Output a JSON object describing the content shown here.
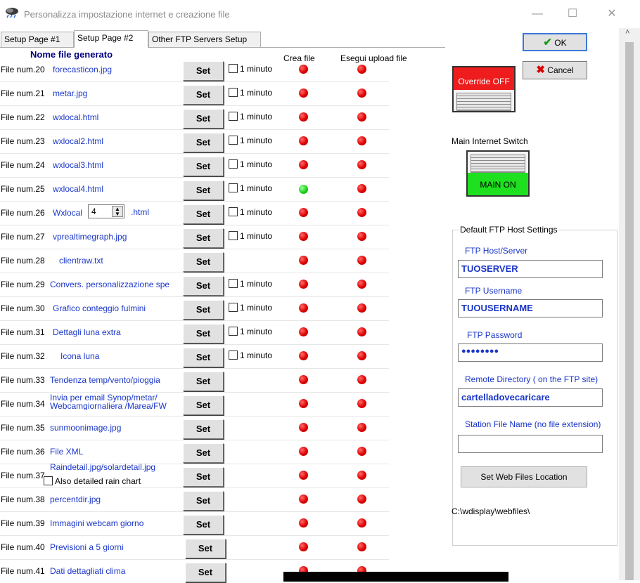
{
  "window": {
    "title": "Personalizza impostazione internet e creazione file",
    "minimize": "—",
    "maximize": "☐",
    "close": "✕"
  },
  "tabs": [
    {
      "label": "Setup Page #1",
      "active": false
    },
    {
      "label": "Setup Page #2",
      "active": true
    },
    {
      "label": "Other FTP Servers Setup",
      "active": false
    }
  ],
  "headers": {
    "filename": "Nome file generato",
    "crea": "Crea file",
    "upload": "Esegui upload file"
  },
  "set_label": "Set",
  "minute_label": "1 minuto",
  "rows": [
    {
      "num": "File num.20",
      "name": "forecasticon.jpg",
      "chk": true,
      "crea": "red",
      "up": "red"
    },
    {
      "num": "File num.21",
      "name": "metar.jpg",
      "chk": true,
      "crea": "red",
      "up": "red"
    },
    {
      "num": "File num.22",
      "name": "wxlocal.html",
      "chk": true,
      "crea": "red",
      "up": "red"
    },
    {
      "num": "File num.23",
      "name": "wxlocal2.html",
      "chk": true,
      "crea": "red",
      "up": "red"
    },
    {
      "num": "File num.24",
      "name": "wxlocal3.html",
      "chk": true,
      "crea": "red",
      "up": "red"
    },
    {
      "num": "File num.25",
      "name": "wxlocal4.html",
      "chk": true,
      "crea": "green",
      "up": "red"
    },
    {
      "num": "File num.26",
      "name": "Wxlocal",
      "spin": "4",
      "suffix": ".html",
      "chk": true,
      "crea": "red",
      "up": "red"
    },
    {
      "num": "File num.27",
      "name": "vprealtimegraph.jpg",
      "chk": true,
      "crea": "red",
      "up": "red"
    },
    {
      "num": "File num.28",
      "name": "clientraw.txt",
      "chk": false,
      "crea": "red",
      "up": "red"
    },
    {
      "num": "File num.29",
      "name": "Convers. personalizzazione spe",
      "chk": true,
      "crea": "red",
      "up": "red"
    },
    {
      "num": "File num.30",
      "name": "Grafico conteggio fulmini",
      "chk": true,
      "crea": "red",
      "up": "red"
    },
    {
      "num": "File num.31",
      "name": "Dettagli luna extra",
      "chk": true,
      "crea": "red",
      "up": "red"
    },
    {
      "num": "File num.32",
      "name": "Icona luna",
      "chk": true,
      "crea": "red",
      "up": "red"
    },
    {
      "num": "File num.33",
      "name": "Tendenza temp/vento/pioggia",
      "chk": false,
      "crea": "red",
      "up": "red"
    },
    {
      "num": "File num.34",
      "name": "Invia per email Synop/metar/",
      "name2": "Webcamgiornaliera /Marea/FW",
      "chk": false,
      "crea": "red",
      "up": "red"
    },
    {
      "num": "File num.35",
      "name": "sunmoonimage.jpg",
      "chk": false,
      "crea": "red",
      "up": "red"
    },
    {
      "num": "File num.36",
      "name": "File XML",
      "chk": false,
      "crea": "red",
      "up": "red"
    },
    {
      "num": "File num.37",
      "name": "Raindetail.jpg/solardetail.jpg",
      "sub": "Also detailed rain chart",
      "chk": false,
      "crea": "red",
      "up": "red"
    },
    {
      "num": "File num.38",
      "name": "percentdir.jpg",
      "chk": false,
      "crea": "red",
      "up": "red"
    },
    {
      "num": "File num.39",
      "name": "Immagini webcam giorno",
      "chk": false,
      "crea": "red",
      "up": "red"
    },
    {
      "num": "File num.40",
      "name": "Previsioni a 5 giorni",
      "chk": false,
      "crea": "red",
      "up": "red"
    },
    {
      "num": "File num.41",
      "name": "Dati dettagliati clima",
      "chk": false,
      "crea": "red",
      "up": "red"
    }
  ],
  "right": {
    "ok": "OK",
    "cancel": "Cancel",
    "override": "Override OFF",
    "main_switch_label": "Main Internet Switch",
    "main_on": "MAIN ON",
    "ftp_group": "Default FTP Host Settings",
    "host_label": "FTP Host/Server",
    "host_value": "TUOSERVER",
    "user_label": "FTP Username",
    "user_value": "TUOUSERNAME",
    "pass_label": "FTP Password",
    "pass_value": "●●●●●●●●",
    "remote_label": "Remote Directory ( on the FTP site)",
    "remote_value": "cartelladovecaricare",
    "station_label": "Station File Name (no file extension)",
    "station_value": "",
    "web_button": "Set Web Files Location",
    "web_path": "C:\\wdisplay\\webfiles\\"
  },
  "colors": {
    "link": "#1a36c8",
    "header": "#000080",
    "led_red": "#e00000",
    "led_green": "#1cd41c"
  }
}
